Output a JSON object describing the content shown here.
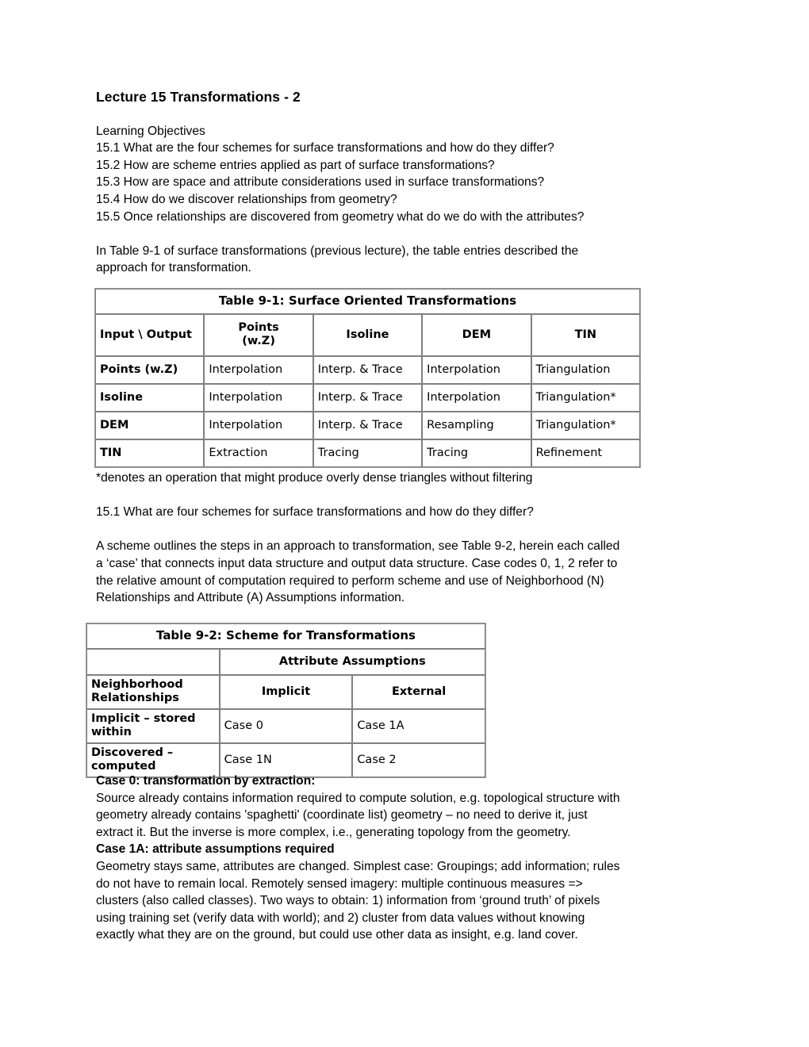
{
  "document": {
    "title": "Lecture 15 Transformations - 2",
    "learning_objectives_heading": "Learning Objectives",
    "objectives": [
      "15.1 What are the four schemes for surface transformations and how do they differ?",
      "15.2 How are scheme entries applied as part of surface transformations?",
      "15.3 How are space and attribute considerations used in surface transformations?",
      "15.4 How do we discover relationships from geometry?",
      "15.5 Once relationships are discovered from geometry what do we do with the attributes?"
    ],
    "intro_paragraph_lines": [
      "In Table 9-1 of surface transformations (previous lecture), the table entries described the",
      "approach for transformation."
    ],
    "table_9_1_footnote": "*denotes an operation that might produce overly dense triangles without filtering",
    "question_15_1": "15.1 What are four schemes for surface transformations and how do they differ?",
    "scheme_paragraph_lines": [
      "A scheme outlines the steps in an approach to transformation, see Table 9-2, herein each called",
      "a ‘case’ that connects input data structure and output data structure. Case codes 0, 1, 2 refer to",
      "the relative amount of computation required to perform scheme and use of Neighborhood (N)",
      "Relationships and Attribute (A) Assumptions information."
    ],
    "case_0_heading": "Case 0: transformation by extraction:",
    "case_0_body_lines": [
      "Source already contains information required to compute solution, e.g. topological structure with",
      "geometry already contains 'spaghetti' (coordinate list) geometry – no need to derive it, just",
      "extract it.   But the inverse is more complex, i.e., generating topology from the geometry."
    ],
    "case_1a_heading": "Case 1A: attribute assumptions required",
    "case_1a_body_lines": [
      "Geometry stays same, attributes are changed. Simplest case: Groupings; add information; rules",
      "do not have to remain local. Remotely sensed imagery: multiple continuous measures =>",
      "clusters (also called classes). Two ways to obtain: 1) information from ‘ground truth’ of pixels",
      "using training set (verify data with world); and 2) cluster from data values without knowing",
      "exactly what they are on the ground, but could use other data as insight, e.g. land cover."
    ]
  },
  "table_9_1": {
    "caption": "Table 9-1: Surface Oriented Transformations",
    "columns": [
      "Input \\ Output",
      "Points (w.Z)",
      "Isoline",
      "DEM",
      "TIN"
    ],
    "column_header_points_line1": "Points",
    "column_header_points_line2": "(w.Z)",
    "rows": [
      {
        "label": "Points (w.Z)",
        "cells": [
          "Interpolation",
          "Interp. & Trace",
          "Interpolation",
          "Triangulation"
        ]
      },
      {
        "label": "Isoline",
        "cells": [
          "Interpolation",
          "Interp. & Trace",
          "Interpolation",
          "Triangulation*"
        ]
      },
      {
        "label": "DEM",
        "cells": [
          "Interpolation",
          "Interp. & Trace",
          "Resampling",
          "Triangulation*"
        ]
      },
      {
        "label": "TIN",
        "cells": [
          "Extraction",
          "Tracing",
          "Tracing",
          "Refinement"
        ]
      }
    ]
  },
  "table_9_2": {
    "caption": "Table 9-2: Scheme for Transformations",
    "attribute_assumptions_header": "Attribute Assumptions",
    "corner_blank": "",
    "neighborhood_header": "Neighborhood Relationships",
    "sub_headers": [
      "Implicit",
      "External"
    ],
    "rows": [
      {
        "label": "Implicit – stored within",
        "cells": [
          "Case 0",
          "Case 1A"
        ]
      },
      {
        "label": "Discovered – computed",
        "cells": [
          "Case 1N",
          "Case 2"
        ]
      }
    ]
  },
  "colors": {
    "text": "#000000",
    "page_background": "#ffffff",
    "table_border": "#808080"
  }
}
